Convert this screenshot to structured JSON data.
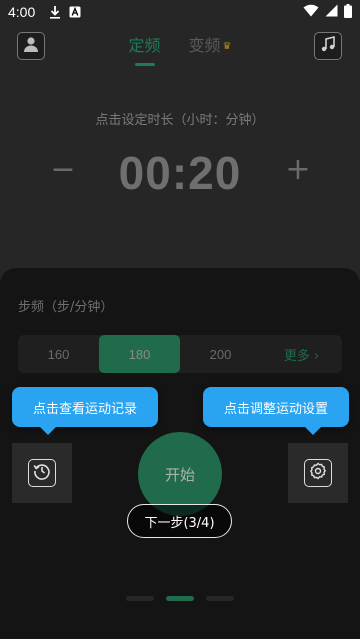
{
  "status_bar": {
    "time": "4:00",
    "icons": [
      "download-icon",
      "a-notification-icon",
      "wifi-icon",
      "signal-icon",
      "battery-icon"
    ]
  },
  "header": {
    "tabs": [
      {
        "label": "定频",
        "active": true
      },
      {
        "label": "变频",
        "active": false,
        "badge": "crown-icon"
      }
    ],
    "left_icon": "user-icon",
    "right_icon": "music-icon"
  },
  "timer": {
    "hint": "点击设定时长（小时：分钟）",
    "value": "00:20",
    "minus": "−",
    "plus": "+"
  },
  "step_frequency": {
    "label": "步频（步/分钟）",
    "options": [
      "160",
      "180",
      "200"
    ],
    "selected": "180",
    "more": "更多 ›"
  },
  "guide": {
    "left_tip": "点击查看运动记录",
    "right_tip": "点击调整运动设置",
    "next": "下一步(3/4)"
  },
  "start_button": "开始",
  "colors": {
    "accent": "#1f6b4b",
    "tooltip": "#2aa3f0",
    "background": "#262626"
  }
}
